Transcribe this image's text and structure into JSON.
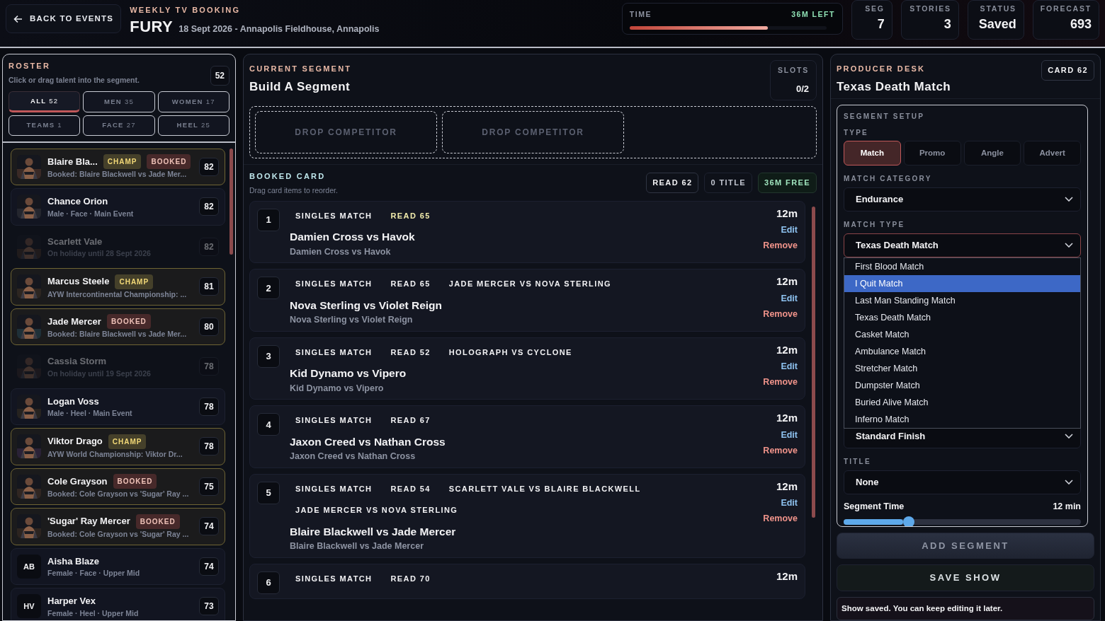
{
  "header": {
    "back_label": "BACK TO EVENTS",
    "eyebrow": "WEEKLY TV BOOKING",
    "show_name": "FURY",
    "show_details": "18 Sept 2026 - Annapolis Fieldhouse, Annapolis"
  },
  "time": {
    "label": "TIME",
    "remaining": "36M LEFT",
    "level": 0.7
  },
  "stats": [
    {
      "label": "SEG",
      "value": "7"
    },
    {
      "label": "STORIES",
      "value": "3"
    },
    {
      "label": "STATUS",
      "value": "Saved"
    },
    {
      "label": "FORECAST",
      "value": "693"
    }
  ],
  "roster": {
    "title": "ROSTER",
    "hint": "Click or drag talent into the segment.",
    "count": "52",
    "filters": [
      {
        "label": "ALL",
        "count": "52",
        "selected": true
      },
      {
        "label": "MEN",
        "count": "35",
        "selected": false
      },
      {
        "label": "WOMEN",
        "count": "17",
        "selected": false
      },
      {
        "label": "TEAMS",
        "count": "1",
        "selected": false
      },
      {
        "label": "FACE",
        "count": "27",
        "selected": false
      },
      {
        "label": "HEEL",
        "count": "25",
        "selected": false
      }
    ],
    "talent": [
      {
        "name": "Blaire Bla...",
        "tags": [
          {
            "kind": "champ",
            "text": "CHAMP"
          },
          {
            "kind": "booked",
            "text": "BOOKED"
          }
        ],
        "detail": "Booked: Blaire Blackwell vs Jade Mer...",
        "rating": "82",
        "highlighted": true,
        "unavailable": false,
        "avatar": {
          "kind": "picture"
        }
      },
      {
        "name": "Chance Orion",
        "detail": "Male · Face · Main Event",
        "rating": "82",
        "highlighted": false,
        "unavailable": false,
        "avatar": {
          "kind": "picture"
        }
      },
      {
        "name": "Scarlett Vale",
        "detail": "On holiday until 28 Sept 2026",
        "rating": "82",
        "highlighted": false,
        "unavailable": true,
        "avatar": {
          "kind": "picture"
        }
      },
      {
        "name": "Marcus Steele",
        "tags": [
          {
            "kind": "champ",
            "text": "CHAMP"
          }
        ],
        "detail": "AYW Intercontinental Championship: ...",
        "rating": "81",
        "highlighted": true,
        "unavailable": false,
        "avatar": {
          "kind": "picture"
        }
      },
      {
        "name": "Jade Mercer",
        "tags": [
          {
            "kind": "booked",
            "text": "BOOKED"
          }
        ],
        "detail": "Booked: Blaire Blackwell vs Jade Mer...",
        "rating": "80",
        "highlighted": true,
        "unavailable": false,
        "avatar": {
          "kind": "picture"
        }
      },
      {
        "name": "Cassia Storm",
        "detail": "On holiday until 19 Sept 2026",
        "rating": "78",
        "highlighted": false,
        "unavailable": true,
        "avatar": {
          "kind": "picture"
        }
      },
      {
        "name": "Logan Voss",
        "detail": "Male · Heel · Main Event",
        "rating": "78",
        "highlighted": false,
        "unavailable": false,
        "avatar": {
          "kind": "picture"
        }
      },
      {
        "name": "Viktor Drago",
        "tags": [
          {
            "kind": "champ",
            "text": "CHAMP"
          }
        ],
        "detail": "AYW World Championship: Viktor Dr...",
        "rating": "78",
        "highlighted": true,
        "unavailable": false,
        "avatar": {
          "kind": "picture"
        }
      },
      {
        "name": "Cole Grayson",
        "tags": [
          {
            "kind": "booked",
            "text": "BOOKED"
          }
        ],
        "detail": "Booked: Cole Grayson vs 'Sugar' Ray ...",
        "rating": "75",
        "highlighted": true,
        "unavailable": false,
        "avatar": {
          "kind": "picture"
        }
      },
      {
        "name": "'Sugar' Ray Mercer",
        "tags": [
          {
            "kind": "booked",
            "text": "BOOKED"
          }
        ],
        "detail": "Booked: Cole Grayson vs 'Sugar' Ray ...",
        "rating": "74",
        "highlighted": true,
        "unavailable": false,
        "avatar": {
          "kind": "picture"
        }
      },
      {
        "name": "Aisha Blaze",
        "detail": "Female · Face · Upper Mid",
        "rating": "74",
        "highlighted": false,
        "unavailable": false,
        "avatar": {
          "kind": "initials",
          "text": "AB"
        }
      },
      {
        "name": "Harper Vex",
        "detail": "Female · Heel · Upper Mid",
        "rating": "73",
        "highlighted": false,
        "unavailable": false,
        "avatar": {
          "kind": "initials",
          "text": "HV"
        }
      }
    ]
  },
  "segment": {
    "eyebrow": "CURRENT SEGMENT",
    "title": "Build A Segment",
    "slots_label": "SLOTS",
    "slots": "0/2",
    "drop_zones": [
      "DROP COMPETITOR",
      "DROP COMPETITOR"
    ]
  },
  "booked": {
    "title": "BOOKED CARD",
    "hint": "Drag card items to reorder.",
    "badges": [
      {
        "kind": "neutral",
        "text": "READ 62"
      },
      {
        "kind": "muted",
        "text": "0 TITLE"
      },
      {
        "kind": "good",
        "text": "36M FREE"
      }
    ],
    "items": [
      {
        "number": "1",
        "tags": [
          {
            "kind": "type",
            "text": "SINGLES MATCH"
          },
          {
            "kind": "read-hot",
            "text": "READ 65"
          }
        ],
        "time": "12m",
        "title": "Damien Cross vs Havok",
        "subtitle": "Damien Cross vs Havok",
        "actions": [
          {
            "kind": "edit",
            "label": "Edit"
          },
          {
            "kind": "remove",
            "label": "Remove"
          }
        ]
      },
      {
        "number": "2",
        "tags": [
          {
            "kind": "type",
            "text": "SINGLES MATCH"
          },
          {
            "kind": "read",
            "text": "READ 65"
          },
          {
            "kind": "story",
            "text": "JADE MERCER VS NOVA STERLING"
          }
        ],
        "time": "12m",
        "title": "Nova Sterling vs Violet Reign",
        "subtitle": "Nova Sterling vs Violet Reign",
        "actions": [
          {
            "kind": "edit",
            "label": "Edit"
          },
          {
            "kind": "remove",
            "label": "Remove"
          }
        ]
      },
      {
        "number": "3",
        "tags": [
          {
            "kind": "type",
            "text": "SINGLES MATCH"
          },
          {
            "kind": "read",
            "text": "READ 52"
          },
          {
            "kind": "story",
            "text": "HOLOGRAPH VS CYCLONE"
          }
        ],
        "time": "12m",
        "title": "Kid Dynamo vs Vipero",
        "subtitle": "Kid Dynamo vs Vipero",
        "actions": [
          {
            "kind": "edit",
            "label": "Edit"
          },
          {
            "kind": "remove",
            "label": "Remove"
          }
        ]
      },
      {
        "number": "4",
        "tags": [
          {
            "kind": "type",
            "text": "SINGLES MATCH"
          },
          {
            "kind": "read",
            "text": "READ 67"
          }
        ],
        "time": "12m",
        "title": "Jaxon Creed vs Nathan Cross",
        "subtitle": "Jaxon Creed vs Nathan Cross",
        "actions": [
          {
            "kind": "edit",
            "label": "Edit"
          },
          {
            "kind": "remove",
            "label": "Remove"
          }
        ]
      },
      {
        "number": "5",
        "tags": [
          {
            "kind": "type",
            "text": "SINGLES MATCH"
          },
          {
            "kind": "read",
            "text": "READ 54"
          },
          {
            "kind": "story",
            "text": "SCARLETT VALE VS BLAIRE BLACKWELL"
          },
          {
            "kind": "story",
            "text": "JADE MERCER VS NOVA STERLING"
          }
        ],
        "time": "12m",
        "title": "Blaire Blackwell vs Jade Mercer",
        "subtitle": "Blaire Blackwell vs Jade Mercer",
        "actions": [
          {
            "kind": "edit",
            "label": "Edit"
          },
          {
            "kind": "remove",
            "label": "Remove"
          }
        ]
      },
      {
        "number": "6",
        "tags": [
          {
            "kind": "type",
            "text": "SINGLES MATCH"
          },
          {
            "kind": "read",
            "text": "READ 70"
          }
        ],
        "time": "12m"
      }
    ]
  },
  "producer": {
    "eyebrow": "PRODUCER DESK",
    "title": "Texas Death Match",
    "card_badge": "CARD 62",
    "setup": {
      "title": "SEGMENT SETUP",
      "type_label": "TYPE",
      "types": [
        {
          "label": "Match",
          "selected": true
        },
        {
          "label": "Promo",
          "selected": false
        },
        {
          "label": "Angle",
          "selected": false
        },
        {
          "label": "Advert",
          "selected": false
        }
      ],
      "fields": [
        {
          "label": "MATCH CATEGORY",
          "value": "Endurance",
          "open": false
        },
        {
          "label": "MATCH TYPE",
          "value": "Texas Death Match",
          "open": true,
          "options": [
            {
              "label": "First Blood Match",
              "highlighted": false
            },
            {
              "label": "I Quit Match",
              "highlighted": true
            },
            {
              "label": "Last Man Standing Match",
              "highlighted": false
            },
            {
              "label": "Texas Death Match",
              "highlighted": false
            },
            {
              "label": "Casket Match",
              "highlighted": false
            },
            {
              "label": "Ambulance Match",
              "highlighted": false
            },
            {
              "label": "Stretcher Match",
              "highlighted": false
            },
            {
              "label": "Dumpster Match",
              "highlighted": false
            },
            {
              "label": "Buried Alive Match",
              "highlighted": false
            },
            {
              "label": "Inferno Match",
              "highlighted": false
            }
          ]
        },
        {
          "value": "Standard Finish",
          "open": false
        },
        {
          "label": "TITLE",
          "value": "None",
          "open": false
        }
      ],
      "slider": {
        "label": "Segment Time",
        "reading": "12 min",
        "level": 0.25
      }
    },
    "buttons": [
      {
        "kind": "secondary",
        "label": "ADD SEGMENT"
      },
      {
        "kind": "primary",
        "label": "SAVE SHOW"
      }
    ],
    "message": "Show saved. You can keep editing it later."
  }
}
